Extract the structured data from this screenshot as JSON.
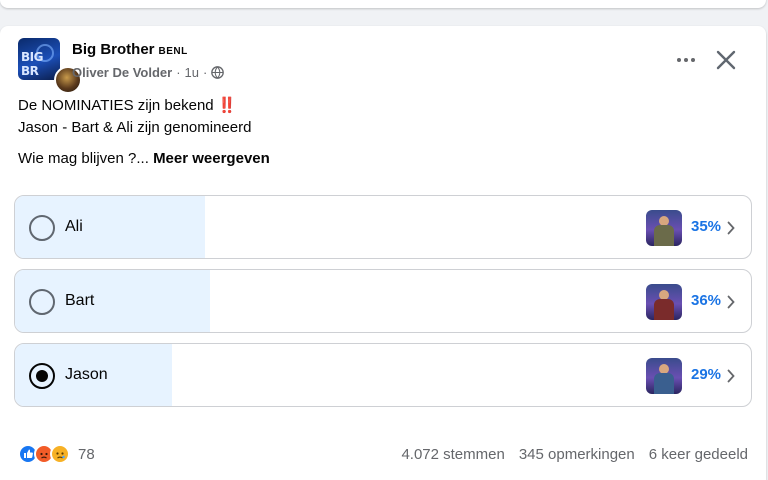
{
  "post": {
    "page_name": "Big Brother",
    "page_badge": "BENL",
    "author": "Oliver De Volder",
    "time": "1u",
    "separator": "·",
    "avatar_text": "BIG BR",
    "text_lines": [
      "De NOMINATIES zijn bekend",
      "Jason - Bart & Ali zijn genomineerd",
      "Wie mag blijven ?..."
    ],
    "emoji": "‼️",
    "see_more": "Meer weergeven"
  },
  "poll": {
    "options": [
      {
        "label": "Ali",
        "percent_text": "35%",
        "percent": 35,
        "selected": false,
        "shirt_color": "#6b6b4a"
      },
      {
        "label": "Bart",
        "percent_text": "36%",
        "percent": 36,
        "selected": false,
        "shirt_color": "#7a2b2b"
      },
      {
        "label": "Jason",
        "percent_text": "29%",
        "percent": 29,
        "selected": true,
        "shirt_color": "#3a5f8f"
      }
    ]
  },
  "footer": {
    "reaction_count": "78",
    "votes": "4.072 stemmen",
    "comments": "345 opmerkingen",
    "shares": "6 keer gedeeld"
  },
  "colors": {
    "accent": "#1b74e4",
    "poll_fill": "#e7f3ff",
    "secondary_text": "#65676b"
  },
  "icons": {
    "more": "more-horizontal-icon",
    "close": "close-icon",
    "audience": "globe-icon",
    "chevron": "chevron-right-icon"
  }
}
